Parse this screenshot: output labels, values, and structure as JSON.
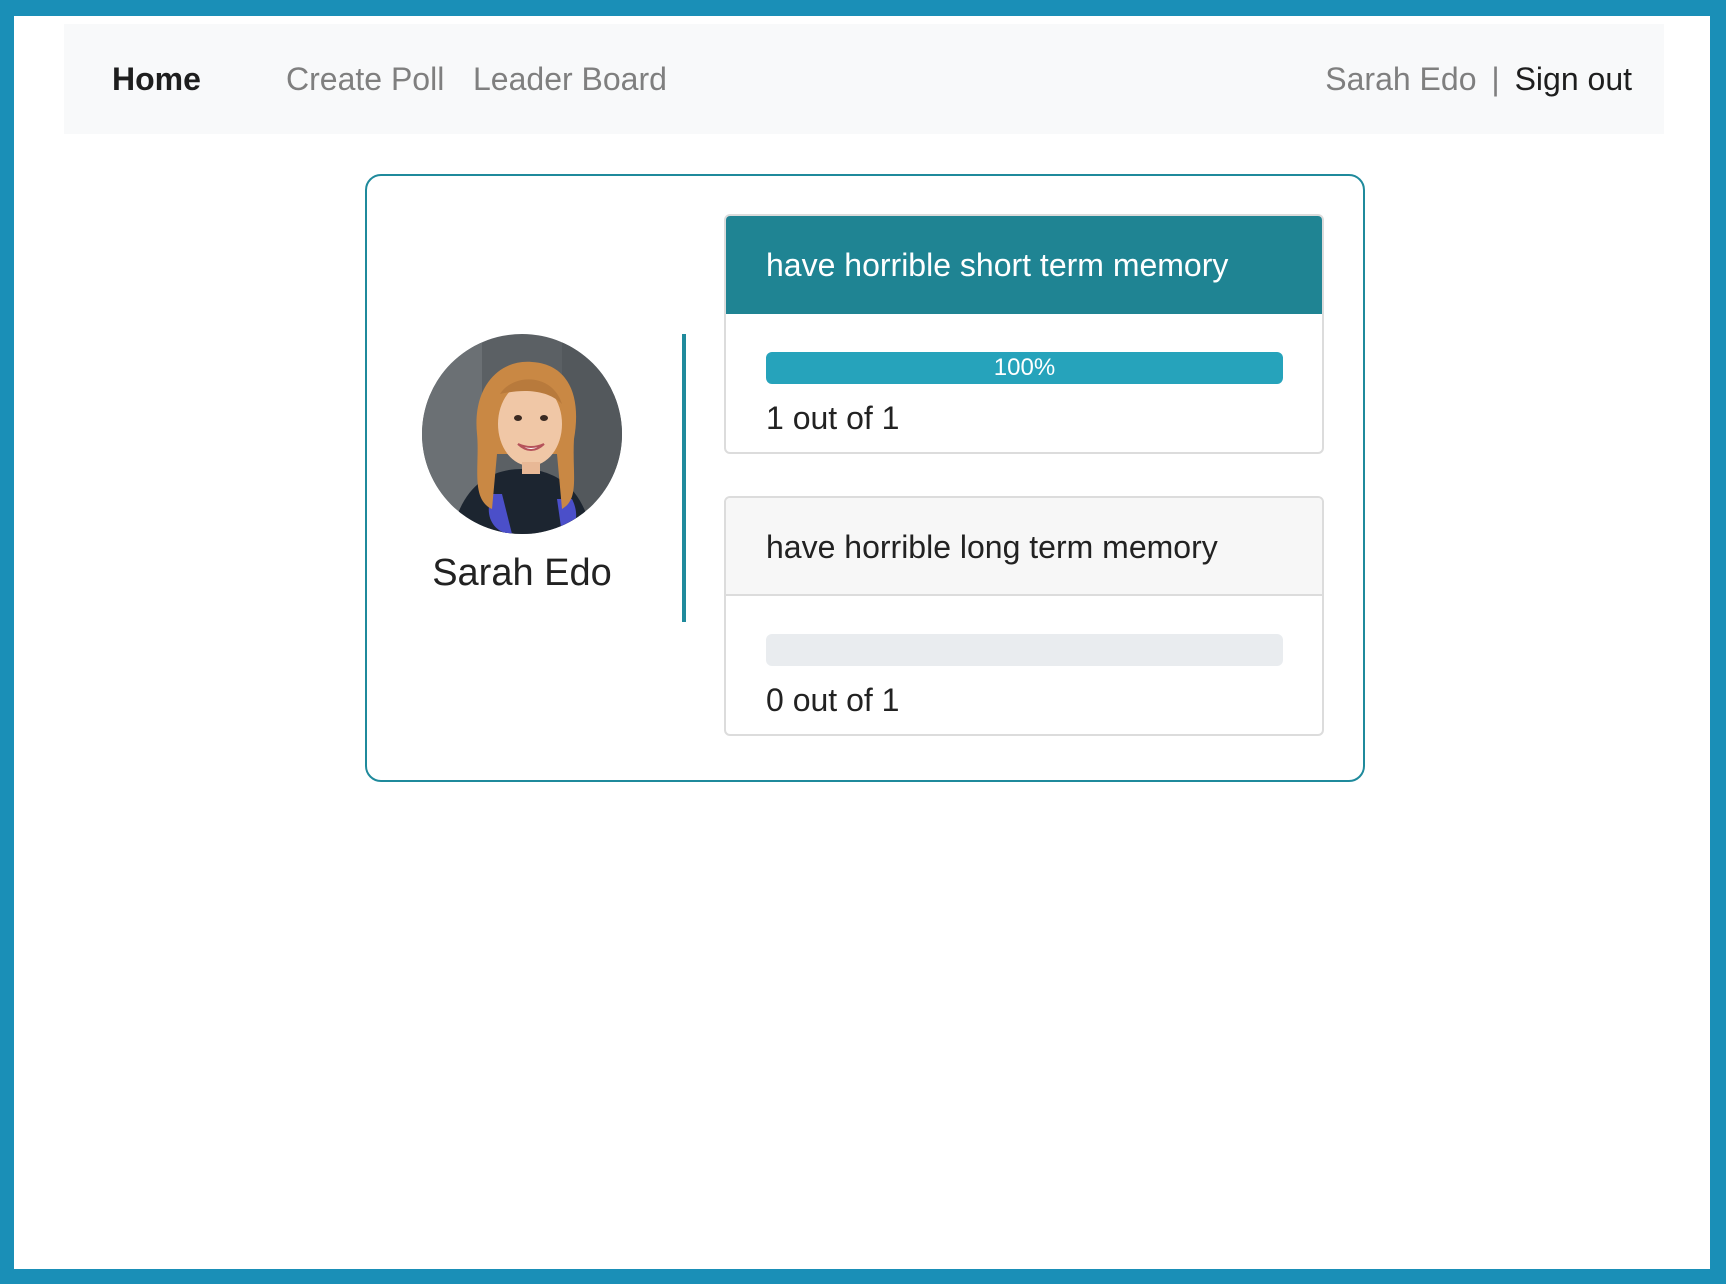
{
  "nav": {
    "home": "Home",
    "create_poll": "Create Poll",
    "leader_board": "Leader Board",
    "user_name": "Sarah Edo",
    "separator": "|",
    "sign_out": "Sign out"
  },
  "poll": {
    "author": "Sarah Edo",
    "options": [
      {
        "text": "have horrible short term memory",
        "percent_label": "100%",
        "percent": 100,
        "count_text": "1 out of 1",
        "selected": true
      },
      {
        "text": "have horrible long term memory",
        "percent_label": "",
        "percent": 0,
        "count_text": "0 out of 1",
        "selected": false
      }
    ]
  },
  "colors": {
    "frame": "#1a8fb7",
    "accent": "#1f8a9c",
    "selected_header": "#1f8493",
    "progress_fill": "#26a3bb"
  }
}
